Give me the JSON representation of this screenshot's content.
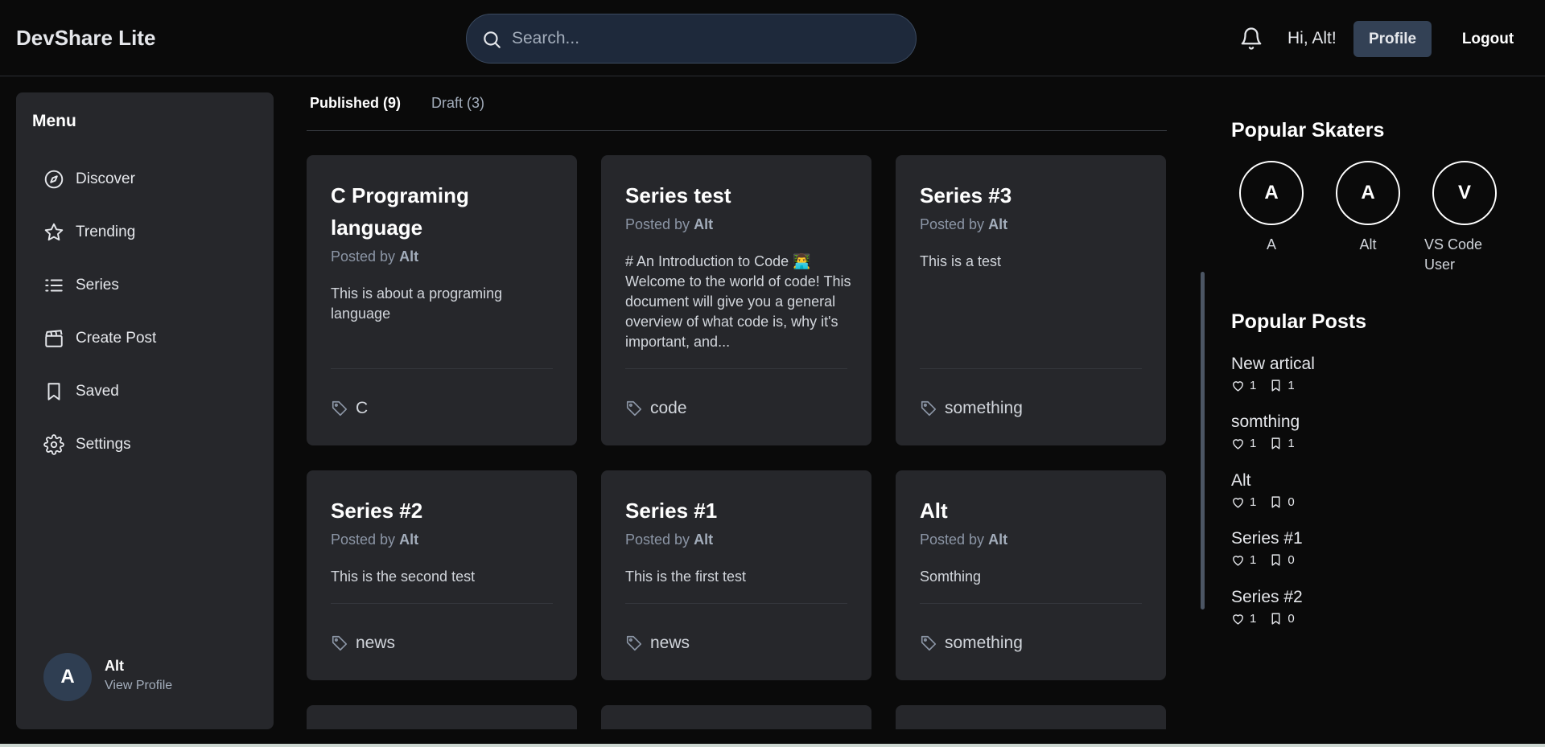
{
  "header": {
    "brand": "DevShare Lite",
    "search_placeholder": "Search...",
    "greeting": "Hi, Alt!",
    "profile_label": "Profile",
    "logout_label": "Logout"
  },
  "sidebar": {
    "title": "Menu",
    "items": [
      {
        "label": "Discover",
        "icon": "compass-icon"
      },
      {
        "label": "Trending",
        "icon": "star-icon"
      },
      {
        "label": "Series",
        "icon": "list-icon"
      },
      {
        "label": "Create Post",
        "icon": "clapperboard-icon"
      },
      {
        "label": "Saved",
        "icon": "bookmark-icon"
      },
      {
        "label": "Settings",
        "icon": "gear-icon"
      }
    ],
    "user": {
      "initial": "A",
      "name": "Alt",
      "link": "View Profile"
    }
  },
  "tabs": {
    "published": "Published (9)",
    "draft": "Draft (3)"
  },
  "cards": [
    {
      "title": "C Programing language",
      "posted_prefix": "Posted by",
      "author": "Alt",
      "excerpt": "This is about a programing language",
      "tag": "C"
    },
    {
      "title": "Series test",
      "posted_prefix": "Posted by",
      "author": "Alt",
      "excerpt": "# An Introduction to Code 👨‍💻 Welcome to the world of code! This document will give you a general overview of what code is, why it's important, and...",
      "tag": "code"
    },
    {
      "title": "Series #3",
      "posted_prefix": "Posted by",
      "author": "Alt",
      "excerpt": "This is a test",
      "tag": "something"
    },
    {
      "title": "Series #2",
      "posted_prefix": "Posted by",
      "author": "Alt",
      "excerpt": "This is the second test",
      "tag": "news"
    },
    {
      "title": "Series #1",
      "posted_prefix": "Posted by",
      "author": "Alt",
      "excerpt": "This is the first test",
      "tag": "news"
    },
    {
      "title": "Alt",
      "posted_prefix": "Posted by",
      "author": "Alt",
      "excerpt": "Somthing",
      "tag": "something"
    }
  ],
  "right": {
    "skaters_title": "Popular Skaters",
    "skaters": [
      {
        "initial": "A",
        "name": "A"
      },
      {
        "initial": "A",
        "name": "Alt"
      },
      {
        "initial": "V",
        "name": "VS Code User"
      }
    ],
    "posts_title": "Popular Posts",
    "posts": [
      {
        "title": "New artical",
        "likes": "1",
        "saves": "1"
      },
      {
        "title": "somthing",
        "likes": "1",
        "saves": "1"
      },
      {
        "title": "Alt",
        "likes": "1",
        "saves": "0"
      },
      {
        "title": "Series #1",
        "likes": "1",
        "saves": "0"
      },
      {
        "title": "Series #2",
        "likes": "1",
        "saves": "0"
      }
    ]
  },
  "colors": {
    "background": "#0a0a0a",
    "panel": "#26272b",
    "accent_button": "#334155",
    "search_bg": "#1e293b"
  }
}
